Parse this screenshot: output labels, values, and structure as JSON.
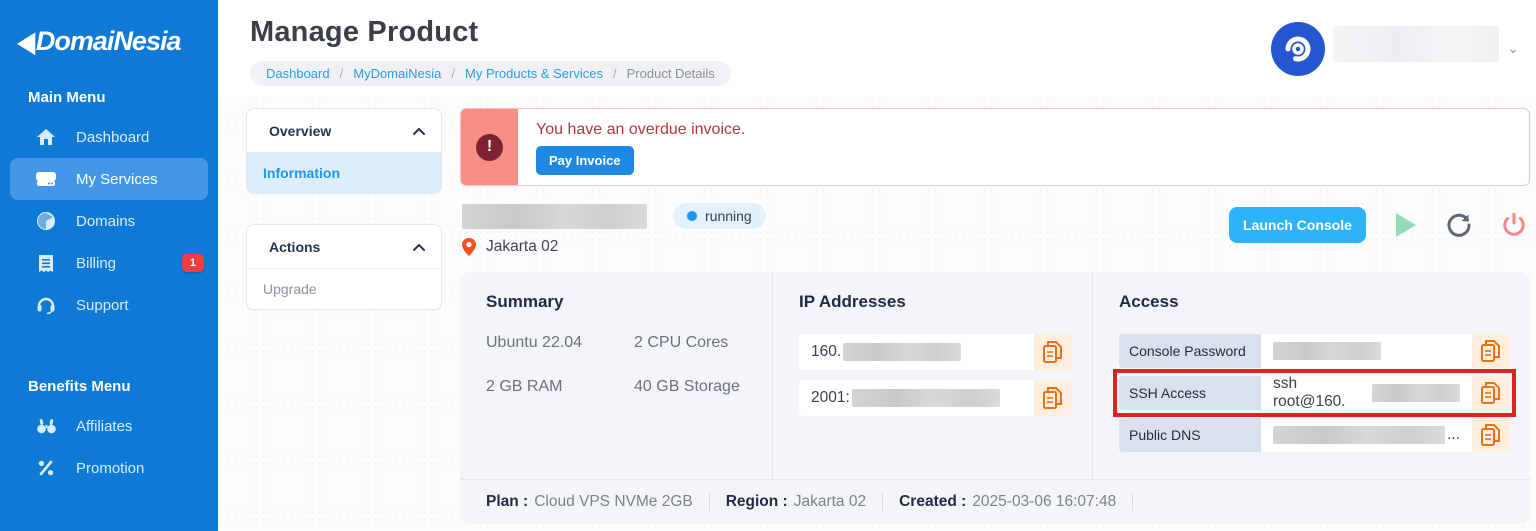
{
  "colors": {
    "sidebar_blue": "#0f7ad6",
    "active_item_blue": "#4397e6",
    "accent_blue": "#2196f3",
    "launch_button_blue": "#2db4f8",
    "pay_button_blue": "#1e88e5",
    "alert_strip_red": "#f58e84",
    "alert_text_red": "#b03a3f",
    "badge_red": "#f03e3e",
    "annotation_red": "#e3201d",
    "copy_icon_orange": "#ed7014",
    "card_gray": "#f3f5f8"
  },
  "sidebar": {
    "logo_text": "DomaiNesia",
    "sections": [
      {
        "heading": "Main Menu",
        "items": [
          {
            "label": "Dashboard",
            "icon": "home-icon"
          },
          {
            "label": "My Services",
            "icon": "server-icon",
            "active": true
          },
          {
            "label": "Domains",
            "icon": "globe-icon"
          },
          {
            "label": "Billing",
            "icon": "receipt-icon",
            "badge": "1"
          },
          {
            "label": "Support",
            "icon": "headset-icon"
          }
        ]
      },
      {
        "heading": "Benefits Menu",
        "items": [
          {
            "label": "Affiliates",
            "icon": "binoculars-icon"
          },
          {
            "label": "Promotion",
            "icon": "percent-icon"
          }
        ]
      }
    ]
  },
  "header": {
    "title": "Manage Product",
    "breadcrumb": {
      "crumb1": "Dashboard",
      "crumb2": "MyDomaiNesia",
      "crumb3": "My Products & Services",
      "crumb4": "Product Details",
      "separator": "/"
    },
    "user_chevron": "⌄"
  },
  "left_panels": {
    "overview": {
      "heading": "Overview",
      "item": "Information"
    },
    "actions": {
      "heading": "Actions",
      "item": "Upgrade"
    }
  },
  "alert": {
    "message": "You have an overdue invoice.",
    "icon_glyph": "!",
    "button_label": "Pay Invoice"
  },
  "server": {
    "status": "running",
    "location": "Jakarta 02",
    "launch_button": "Launch Console"
  },
  "details": {
    "summary": {
      "heading": "Summary",
      "os": "Ubuntu 22.04",
      "cpu": "2 CPU Cores",
      "ram": "2 GB RAM",
      "storage": "40 GB Storage"
    },
    "ip": {
      "heading": "IP Addresses",
      "ipv4_visible": "160.",
      "ipv6_visible": "2001:"
    },
    "access": {
      "heading": "Access",
      "row1_label": "Console Password",
      "row2_label": "SSH Access",
      "row2_value_visible": "ssh root@160.",
      "row3_label": "Public DNS",
      "row3_suffix": "..."
    }
  },
  "footer": {
    "plan_label": "Plan :",
    "plan_value": "Cloud VPS NVMe 2GB",
    "region_label": "Region :",
    "region_value": "Jakarta 02",
    "created_label": "Created :",
    "created_value": "2025-03-06 16:07:48"
  }
}
